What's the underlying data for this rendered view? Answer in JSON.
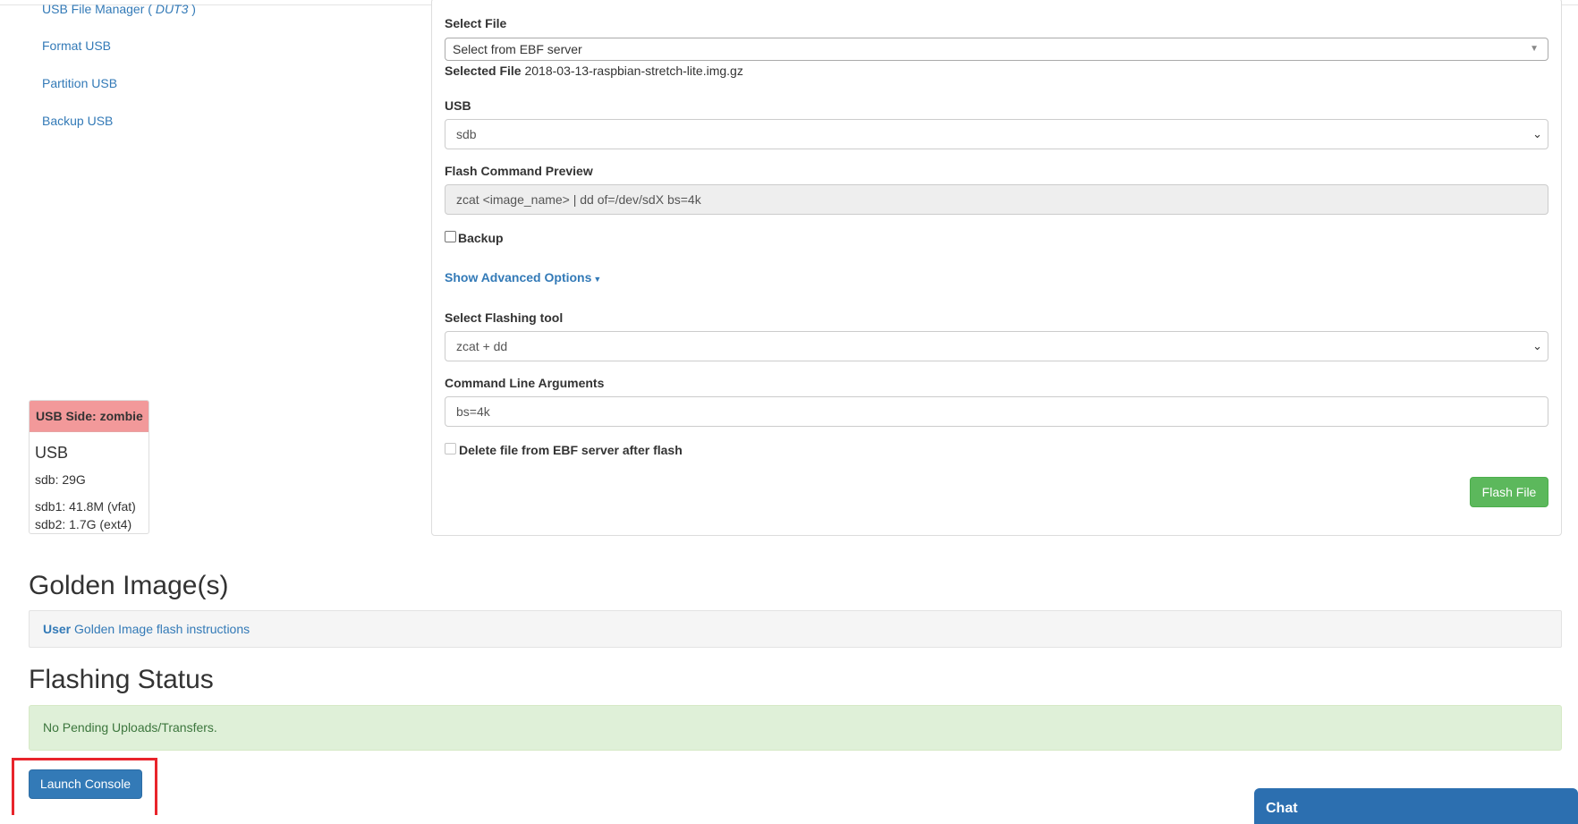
{
  "sidebar": {
    "links": [
      {
        "label": "USB File Manager (",
        "emph": "DUT3",
        "suffix": ")"
      },
      {
        "label": "Format USB"
      },
      {
        "label": "Partition USB"
      },
      {
        "label": "Backup USB"
      }
    ]
  },
  "usb_status": {
    "header": "USB Side: zombie",
    "title": "USB",
    "device": "sdb: 29G",
    "partitions": [
      "sdb1: 41.8M (vfat)",
      "sdb2: 1.7G (ext4)"
    ]
  },
  "form": {
    "select_file_label": "Select File",
    "select_file_value": "Select from EBF server",
    "selected_file_label": "Selected File",
    "selected_file_value": "2018-03-13-raspbian-stretch-lite.img.gz",
    "usb_label": "USB",
    "usb_value": "sdb",
    "preview_label": "Flash Command Preview",
    "preview_value": "zcat <image_name> | dd of=/dev/sdX bs=4k",
    "backup_label": "Backup",
    "advanced_label": "Show Advanced Options",
    "tool_label": "Select Flashing tool",
    "tool_value": "zcat + dd",
    "args_label": "Command Line Arguments",
    "args_value": "bs=4k",
    "delete_label": "Delete file from EBF server after flash",
    "flash_button": "Flash File"
  },
  "golden": {
    "heading": "Golden Image(s)",
    "user": "User",
    "link": "Golden Image flash instructions"
  },
  "status": {
    "heading": "Flashing Status",
    "message": "No Pending Uploads/Transfers."
  },
  "launch_button": "Launch Console",
  "chat_label": "Chat",
  "colors": {
    "link": "#337ab7",
    "success": "#5cb85c",
    "primary": "#337ab7",
    "danger_panel": "#f2999a",
    "alert_success_bg": "#dff0d8",
    "highlight": "#e8242b"
  }
}
